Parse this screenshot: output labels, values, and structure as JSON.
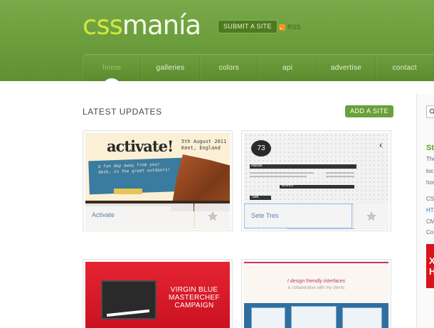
{
  "header": {
    "logo_part1": "css",
    "logo_part2": "manía",
    "submit_label": "SUBMIT A SITE",
    "rss_label": "RSS"
  },
  "nav": {
    "items": [
      {
        "label": "home",
        "active": true
      },
      {
        "label": "galleries"
      },
      {
        "label": "colors"
      },
      {
        "label": "api"
      },
      {
        "label": "advertise"
      },
      {
        "label": "contact"
      }
    ]
  },
  "main": {
    "section_title": "LATEST UPDATES",
    "add_site_label": "ADD A SITE",
    "cards": [
      {
        "title": "Activate",
        "thumb": {
          "headline": "activate!",
          "date_line1": "5th August 2011",
          "date_line2": "Kent, England",
          "banner_line1": "a fun day away from your",
          "banner_line2": "desk, in the great outdoors!"
        }
      },
      {
        "title": "Sete Tres",
        "thumb": {
          "badge": "73",
          "about": "About",
          "works": "Works",
          "talk": "Talk"
        }
      },
      {
        "title": "",
        "thumb": {
          "headline_line1": "VIRGIN BLUE",
          "headline_line2": "MASTERCHEF",
          "headline_line3": "CAMPAIGN"
        }
      },
      {
        "title": "",
        "thumb": {
          "tagline": "I design friendly interfaces",
          "sub": "& collaborative with my clients"
        }
      }
    ]
  },
  "sidebar": {
    "heading": "St",
    "lines": [
      "The",
      "loc",
      "hos"
    ],
    "links": [
      "CS",
      "HT",
      "CM",
      "Co"
    ],
    "ad_text": "X H"
  },
  "colors": {
    "brand_green": "#6a9c3a",
    "logo_lime": "#cfe73c",
    "link_blue": "#5a7fb2",
    "accent_button": "#6aa13b"
  }
}
